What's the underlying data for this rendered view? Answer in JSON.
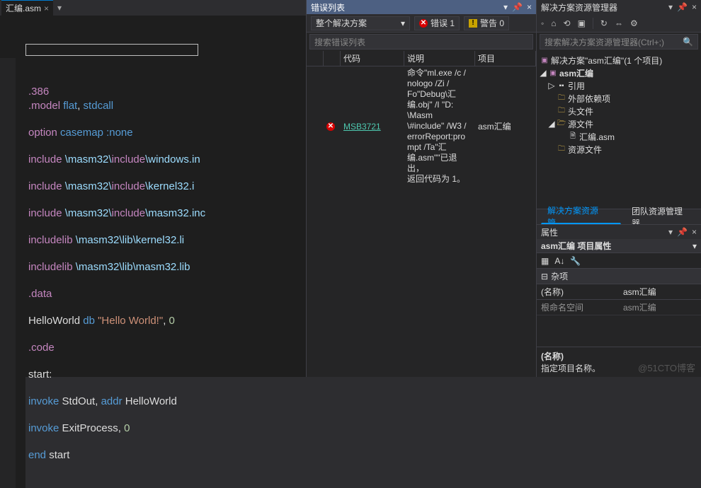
{
  "editor": {
    "tab_name": "汇编.asm",
    "code": {
      "l1": ".386",
      "l2": {
        "a": ".model",
        "b": " flat",
        "c": ",",
        "d": " stdcall"
      },
      "l3": {
        "a": "option",
        "b": " casemap :none"
      },
      "l4": {
        "a": "include",
        "b": " \\masm32\\",
        "c": "include",
        "d": "\\windows.in"
      },
      "l5": {
        "a": "include",
        "b": " \\masm32\\",
        "c": "include",
        "d": "\\kernel32.i"
      },
      "l6": {
        "a": "include",
        "b": " \\masm32\\",
        "c": "include",
        "d": "\\masm32.inc"
      },
      "l7": {
        "a": "includelib",
        "b": " \\masm32\\lib\\kernel32.li"
      },
      "l8": {
        "a": "includelib",
        "b": " \\masm32\\lib\\masm32.lib"
      },
      "l9": ".data",
      "l10": {
        "a": "HelloWorld ",
        "b": "db ",
        "c": "\"Hello World!\"",
        "d": ", ",
        "e": "0"
      },
      "l11": ".code",
      "l12": "start:",
      "l13": {
        "a": "invoke",
        "b": " StdOut, ",
        "c": "addr",
        "d": " HelloWorld"
      },
      "l14": {
        "a": "invoke",
        "b": " ExitProcess, ",
        "c": "0"
      },
      "l15": {
        "a": "end",
        "b": " start"
      }
    }
  },
  "errorlist": {
    "title": "错误列表",
    "scope": "整个解决方案",
    "errors_label": "错误 1",
    "warnings_label": "警告 0",
    "search_placeholder": "搜索错误列表",
    "cols": {
      "code": "代码",
      "desc": "说明",
      "proj": "项目"
    },
    "row": {
      "code": "MSB3721",
      "desc": "命令\"ml.exe /c /\nnologo /Zi /\nFo\"Debug\\汇\n编.obj\" /I \"D:\n\\Masm\n\\#include\" /W3 /\nerrorReport:pro\nmpt /Ta\"汇\n编.asm\"\"已退出，\n返回代码为 1。",
      "proj": "asm汇编"
    }
  },
  "solution_explorer": {
    "title": "解决方案资源管理器",
    "search_placeholder": "搜索解决方案资源管理器(Ctrl+;)",
    "solution_label": "解决方案\"asm汇编\"(1 个项目)",
    "project": "asm汇编",
    "nodes": {
      "refs": "引用",
      "externals": "外部依赖项",
      "headers": "头文件",
      "sources": "源文件",
      "file1": "汇编.asm",
      "resources": "资源文件"
    },
    "tab_active": "解决方案资源管…",
    "tab_other": "团队资源管理器"
  },
  "properties": {
    "title": "属性",
    "subject": "asm汇编 项目属性",
    "cat": "杂项",
    "rows": {
      "name_k": "(名称)",
      "name_v": "asm汇编",
      "ns_k": "根命名空间",
      "ns_v": "asm汇编"
    },
    "desc_k": "(名称)",
    "desc": "指定项目名称。"
  },
  "watermark": "@51CTO博客"
}
